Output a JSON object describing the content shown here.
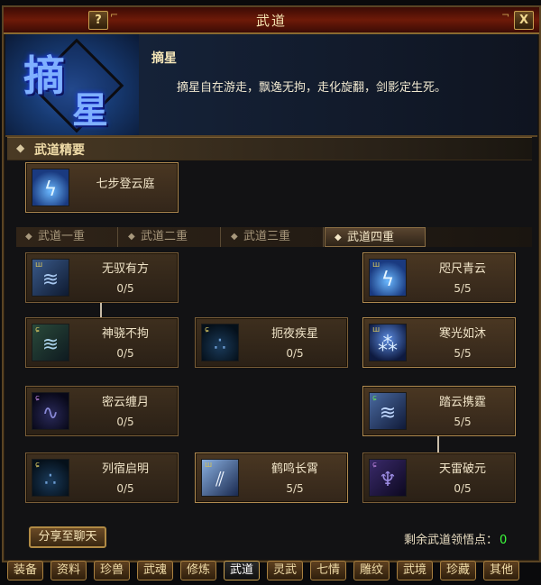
{
  "window": {
    "title": "武道",
    "help_label": "?",
    "close_label": "X"
  },
  "skill": {
    "emblem_chars": [
      "摘",
      "星"
    ],
    "name": "摘星",
    "description": "摘星自在游走，飘逸无拘，走化旋翻，剑影定生死。"
  },
  "essentials": {
    "header": "武道精要",
    "item": {
      "name": "七步登云庭",
      "icon": "figure-lightning-icon"
    }
  },
  "tabs": [
    {
      "label": "武道一重",
      "active": false
    },
    {
      "label": "武道二重",
      "active": false
    },
    {
      "label": "武道三重",
      "active": false
    },
    {
      "label": "武道四重",
      "active": true
    }
  ],
  "nodes": [
    {
      "name": "无驭有方",
      "progress": "0/5",
      "lit": false,
      "icon": "scroll-icon"
    },
    {
      "name": "咫尺青云",
      "progress": "5/5",
      "lit": true,
      "icon": "figure-lightning-icon"
    },
    {
      "name": "神骁不拘",
      "progress": "0/5",
      "lit": false,
      "icon": "spiral-scroll-icon"
    },
    {
      "name": "扼夜疾星",
      "progress": "0/5",
      "lit": false,
      "icon": "orbs-icon"
    },
    {
      "name": "寒光如沐",
      "progress": "5/5",
      "lit": true,
      "icon": "sword-rain-icon"
    },
    {
      "name": "密云缠月",
      "progress": "0/5",
      "lit": false,
      "icon": "purple-swirl-icon"
    },
    {
      "name": "踏云携霆",
      "progress": "5/5",
      "lit": true,
      "icon": "wing-icon"
    },
    {
      "name": "列宿启明",
      "progress": "0/5",
      "lit": false,
      "icon": "orbs-icon"
    },
    {
      "name": "鹤鸣长霄",
      "progress": "5/5",
      "lit": true,
      "icon": "blade-flash-icon"
    },
    {
      "name": "天雷破元",
      "progress": "0/5",
      "lit": false,
      "icon": "purple-figure-icon"
    }
  ],
  "footer": {
    "share_label": "分享至聊天",
    "points_label": "剩余武道领悟点：",
    "points_value": "0"
  },
  "bottom_nav": [
    {
      "label": "装备",
      "active": false
    },
    {
      "label": "资料",
      "active": false
    },
    {
      "label": "珍兽",
      "active": false
    },
    {
      "label": "武魂",
      "active": false
    },
    {
      "label": "修炼",
      "active": false
    },
    {
      "label": "武道",
      "active": true
    },
    {
      "label": "灵武",
      "active": false
    },
    {
      "label": "七情",
      "active": false
    },
    {
      "label": "雕纹",
      "active": false
    },
    {
      "label": "武境",
      "active": false
    },
    {
      "label": "珍藏",
      "active": false
    },
    {
      "label": "其他",
      "active": false
    }
  ],
  "colors": {
    "title_bar": "#6e1a08",
    "frame_gold": "#b08a50",
    "points_value": "#3cff3c",
    "emblem_blue": "#7fb0ff"
  }
}
